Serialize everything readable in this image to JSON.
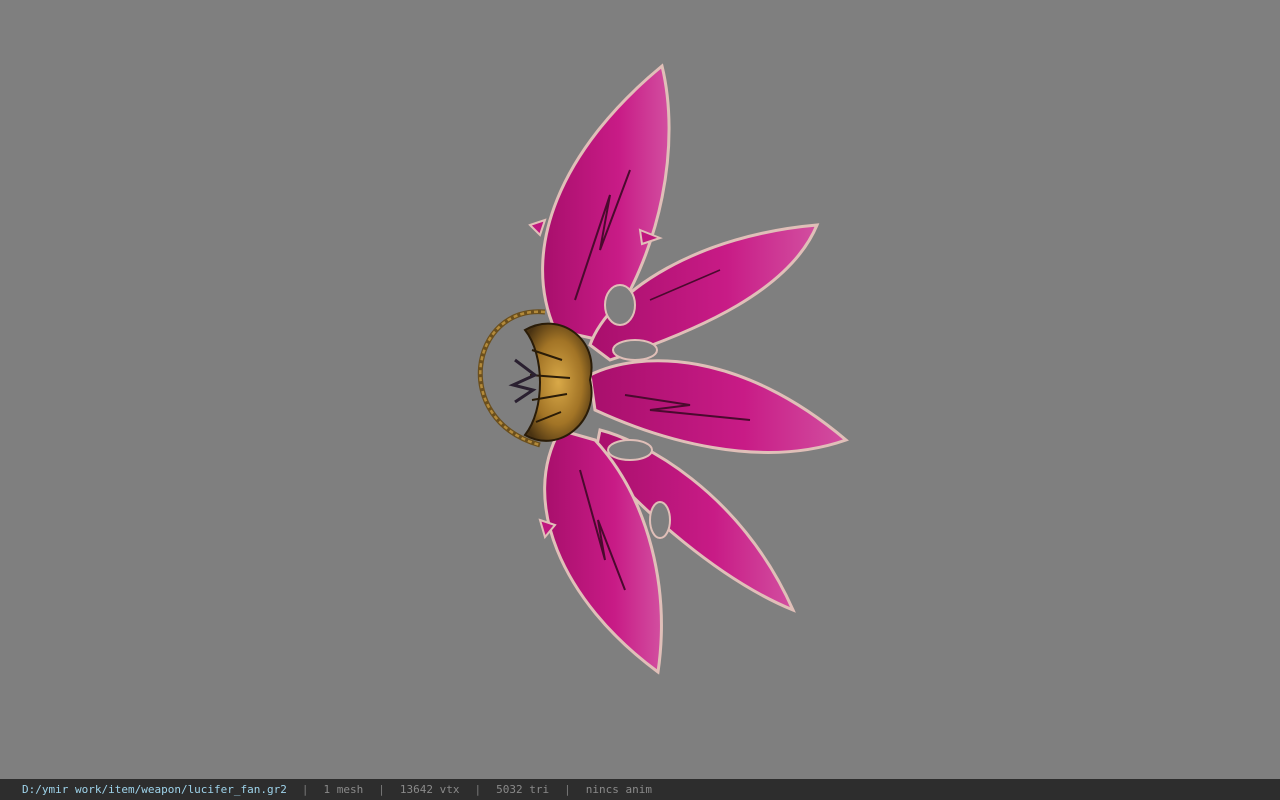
{
  "viewport": {
    "background_color": "#7f7f7f",
    "model_icon": "pink-fan-weapon-icon",
    "colors": {
      "blade": "#c0177f",
      "blade_light": "#d95aa6",
      "blade_edge": "#e9c9c0",
      "hilt_gold": "#a77a2a",
      "hilt_dark": "#3a2a14",
      "chain": "#8a6a2a"
    }
  },
  "status_bar": {
    "file_path": "D:/ymir work/item/weapon/lucifer_fan.gr2",
    "separator": "|",
    "mesh_count": "1 mesh",
    "vertex_count": "13642 vtx",
    "triangle_count": "5032 tri",
    "animation": "nincs anim",
    "path_color": "#9ed3ea",
    "background_color": "#2d2d2d"
  }
}
